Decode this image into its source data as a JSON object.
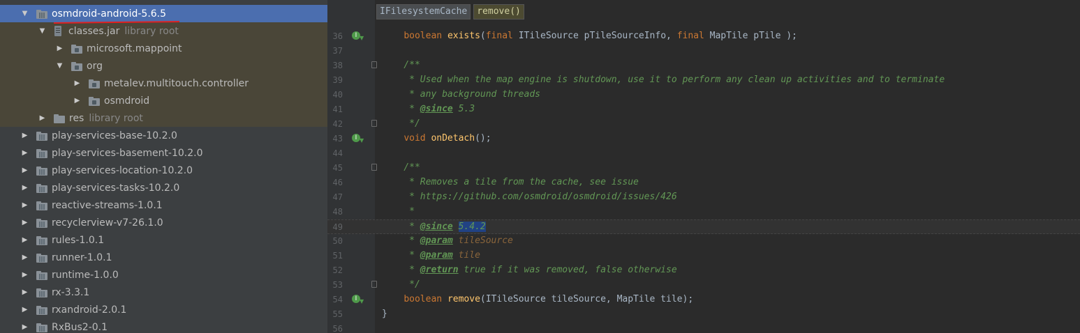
{
  "tree": {
    "items": [
      {
        "label": "osmdroid-android-5.6.5",
        "hint": "",
        "arrow": "▼",
        "type": "lib",
        "selected": true
      },
      {
        "label": "classes.jar",
        "hint": "library root",
        "arrow": "▼",
        "type": "jar",
        "selected": false
      },
      {
        "label": "microsoft.mappoint",
        "hint": "",
        "arrow": "▶",
        "type": "pkg",
        "selected": false
      },
      {
        "label": "org",
        "hint": "",
        "arrow": "▼",
        "type": "pkg",
        "selected": false
      },
      {
        "label": "metalev.multitouch.controller",
        "hint": "",
        "arrow": "▶",
        "type": "pkg",
        "selected": false
      },
      {
        "label": "osmdroid",
        "hint": "",
        "arrow": "▶",
        "type": "pkg",
        "selected": false
      },
      {
        "label": "res",
        "hint": "library root",
        "arrow": "▶",
        "type": "folder",
        "selected": false
      },
      {
        "label": "play-services-base-10.2.0",
        "hint": "",
        "arrow": "▶",
        "type": "lib",
        "selected": false
      },
      {
        "label": "play-services-basement-10.2.0",
        "hint": "",
        "arrow": "▶",
        "type": "lib",
        "selected": false
      },
      {
        "label": "play-services-location-10.2.0",
        "hint": "",
        "arrow": "▶",
        "type": "lib",
        "selected": false
      },
      {
        "label": "play-services-tasks-10.2.0",
        "hint": "",
        "arrow": "▶",
        "type": "lib",
        "selected": false
      },
      {
        "label": "reactive-streams-1.0.1",
        "hint": "",
        "arrow": "▶",
        "type": "lib",
        "selected": false
      },
      {
        "label": "recyclerview-v7-26.1.0",
        "hint": "",
        "arrow": "▶",
        "type": "lib",
        "selected": false
      },
      {
        "label": "rules-1.0.1",
        "hint": "",
        "arrow": "▶",
        "type": "lib",
        "selected": false
      },
      {
        "label": "runner-1.0.1",
        "hint": "",
        "arrow": "▶",
        "type": "lib",
        "selected": false
      },
      {
        "label": "runtime-1.0.0",
        "hint": "",
        "arrow": "▶",
        "type": "lib",
        "selected": false
      },
      {
        "label": "rx-3.3.1",
        "hint": "",
        "arrow": "▶",
        "type": "lib",
        "selected": false
      },
      {
        "label": "rxandroid-2.0.1",
        "hint": "",
        "arrow": "▶",
        "type": "lib",
        "selected": false
      },
      {
        "label": "RxBus2-0.1",
        "hint": "",
        "arrow": "▶",
        "type": "lib",
        "selected": false
      }
    ]
  },
  "editor": {
    "breadcrumbs": [
      "IFilesystemCache",
      "remove()"
    ],
    "lines": [
      {
        "n": "36",
        "gutter": "implemented",
        "fold": false,
        "parts": [
          [
            "",
            "    "
          ],
          [
            "kw",
            "boolean "
          ],
          [
            "fn",
            "exists"
          ],
          [
            "",
            "("
          ],
          [
            "kw",
            "final "
          ],
          [
            "",
            "ITileSource pTileSourceInfo, "
          ],
          [
            "kw",
            "final "
          ],
          [
            "",
            "MapTile pTile );"
          ]
        ]
      },
      {
        "n": "37",
        "gutter": "",
        "fold": false,
        "parts": []
      },
      {
        "n": "38",
        "gutter": "",
        "fold": true,
        "parts": [
          [
            "cm",
            "    /**"
          ]
        ]
      },
      {
        "n": "39",
        "gutter": "",
        "fold": false,
        "parts": [
          [
            "cm",
            "     * Used when the map engine is shutdown, use it to perform any clean up activities and to terminate"
          ]
        ]
      },
      {
        "n": "40",
        "gutter": "",
        "fold": false,
        "parts": [
          [
            "cm",
            "     * any background threads"
          ]
        ]
      },
      {
        "n": "41",
        "gutter": "",
        "fold": false,
        "parts": [
          [
            "cm",
            "     * "
          ],
          [
            "tag",
            "@since"
          ],
          [
            "cm",
            " 5.3"
          ]
        ]
      },
      {
        "n": "42",
        "gutter": "",
        "fold": true,
        "parts": [
          [
            "cm",
            "     */"
          ]
        ]
      },
      {
        "n": "43",
        "gutter": "implemented",
        "fold": false,
        "parts": [
          [
            "",
            "    "
          ],
          [
            "kw",
            "void "
          ],
          [
            "fn",
            "onDetach"
          ],
          [
            "",
            "();"
          ]
        ]
      },
      {
        "n": "44",
        "gutter": "",
        "fold": false,
        "parts": []
      },
      {
        "n": "45",
        "gutter": "",
        "fold": true,
        "parts": [
          [
            "cm",
            "    /**"
          ]
        ]
      },
      {
        "n": "46",
        "gutter": "",
        "fold": false,
        "parts": [
          [
            "cm",
            "     * Removes a tile from the cache, see issue"
          ]
        ]
      },
      {
        "n": "47",
        "gutter": "",
        "fold": false,
        "parts": [
          [
            "cm",
            "     * https://github.com/osmdroid/osmdroid/issues/426"
          ]
        ]
      },
      {
        "n": "48",
        "gutter": "",
        "fold": false,
        "parts": [
          [
            "cm",
            "     *"
          ]
        ]
      },
      {
        "n": "49",
        "gutter": "",
        "fold": false,
        "current": true,
        "parts": [
          [
            "cm",
            "     * "
          ],
          [
            "tag",
            "@since"
          ],
          [
            "cm",
            " "
          ],
          [
            "hl cm",
            "5.4.2"
          ]
        ]
      },
      {
        "n": "50",
        "gutter": "",
        "fold": false,
        "parts": [
          [
            "cm",
            "     * "
          ],
          [
            "tag",
            "@param"
          ],
          [
            "cm",
            " "
          ],
          [
            "tagv",
            "tileSource"
          ]
        ]
      },
      {
        "n": "51",
        "gutter": "",
        "fold": false,
        "parts": [
          [
            "cm",
            "     * "
          ],
          [
            "tag",
            "@param"
          ],
          [
            "cm",
            " "
          ],
          [
            "tagv",
            "tile"
          ]
        ]
      },
      {
        "n": "52",
        "gutter": "",
        "fold": false,
        "parts": [
          [
            "cm",
            "     * "
          ],
          [
            "tag",
            "@return"
          ],
          [
            "cm",
            " true if it was removed, false otherwise"
          ]
        ]
      },
      {
        "n": "53",
        "gutter": "",
        "fold": true,
        "parts": [
          [
            "cm",
            "     */"
          ]
        ]
      },
      {
        "n": "54",
        "gutter": "implemented",
        "fold": false,
        "parts": [
          [
            "",
            "    "
          ],
          [
            "kw",
            "boolean "
          ],
          [
            "fn",
            "remove"
          ],
          [
            "",
            "(ITileSource tileSource, MapTile tile);"
          ]
        ]
      },
      {
        "n": "55",
        "gutter": "",
        "fold": false,
        "parts": [
          [
            "",
            "}"
          ]
        ]
      },
      {
        "n": "56",
        "gutter": "",
        "fold": false,
        "parts": []
      }
    ]
  }
}
